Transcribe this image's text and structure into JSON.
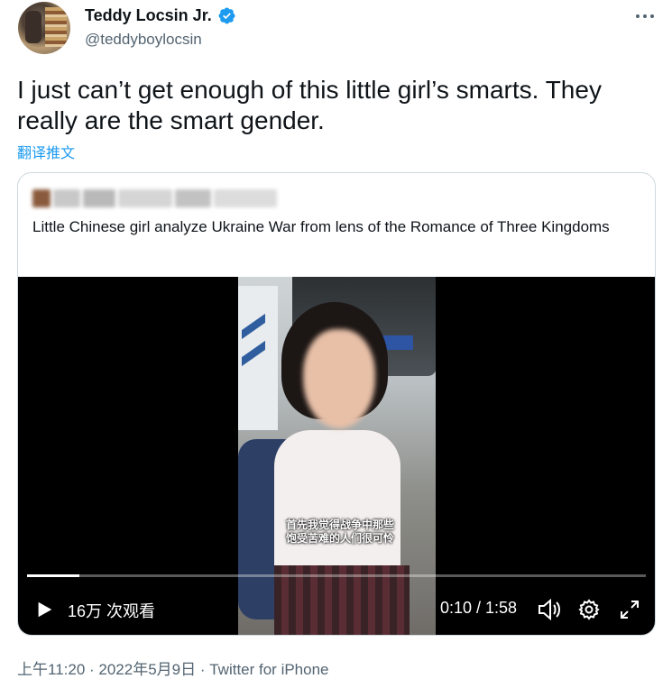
{
  "author": {
    "display_name": "Teddy Locsin Jr.",
    "handle": "@teddyboylocsin",
    "verified_icon": "verified-badge-icon",
    "verified_color": "#1d9bf0"
  },
  "more_icon": "more-options-icon",
  "tweet": {
    "text": "I just can’t get enough of this little girl’s smarts. They really are the smart gender.",
    "translate_label": "翻译推文"
  },
  "quoted": {
    "text": "Little Chinese girl analyze Ukraine War from lens of the Romance of Three Kingdoms",
    "video": {
      "subtitle": "首先我觉得战争中那些饱受苦难的人们很可怜",
      "views": "16万 次观看",
      "time": "0:10 / 1:58",
      "progress": 0.085,
      "icons": [
        "play-icon",
        "volume-icon",
        "settings-icon",
        "fullscreen-icon"
      ]
    }
  },
  "meta": {
    "timestamp_source": "上午11:20 · 2022年5月9日 · Twitter for iPhone"
  },
  "colors": {
    "link": "#1d9bf0",
    "secondary_text": "#536471",
    "border": "#cfd9de"
  }
}
